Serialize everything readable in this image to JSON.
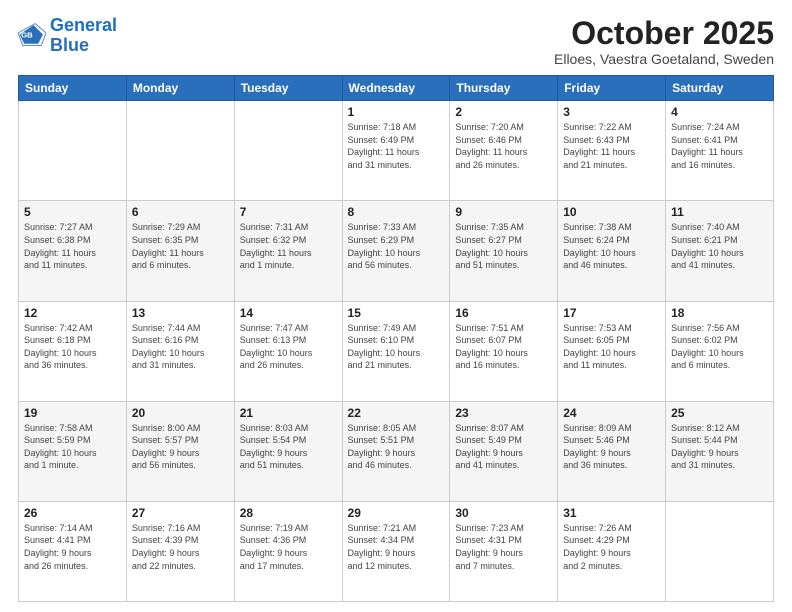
{
  "logo": {
    "line1": "General",
    "line2": "Blue"
  },
  "title": "October 2025",
  "subtitle": "Elloes, Vaestra Goetaland, Sweden",
  "weekdays": [
    "Sunday",
    "Monday",
    "Tuesday",
    "Wednesday",
    "Thursday",
    "Friday",
    "Saturday"
  ],
  "weeks": [
    [
      {
        "day": "",
        "info": ""
      },
      {
        "day": "",
        "info": ""
      },
      {
        "day": "",
        "info": ""
      },
      {
        "day": "1",
        "info": "Sunrise: 7:18 AM\nSunset: 6:49 PM\nDaylight: 11 hours\nand 31 minutes."
      },
      {
        "day": "2",
        "info": "Sunrise: 7:20 AM\nSunset: 6:46 PM\nDaylight: 11 hours\nand 26 minutes."
      },
      {
        "day": "3",
        "info": "Sunrise: 7:22 AM\nSunset: 6:43 PM\nDaylight: 11 hours\nand 21 minutes."
      },
      {
        "day": "4",
        "info": "Sunrise: 7:24 AM\nSunset: 6:41 PM\nDaylight: 11 hours\nand 16 minutes."
      }
    ],
    [
      {
        "day": "5",
        "info": "Sunrise: 7:27 AM\nSunset: 6:38 PM\nDaylight: 11 hours\nand 11 minutes."
      },
      {
        "day": "6",
        "info": "Sunrise: 7:29 AM\nSunset: 6:35 PM\nDaylight: 11 hours\nand 6 minutes."
      },
      {
        "day": "7",
        "info": "Sunrise: 7:31 AM\nSunset: 6:32 PM\nDaylight: 11 hours\nand 1 minute."
      },
      {
        "day": "8",
        "info": "Sunrise: 7:33 AM\nSunset: 6:29 PM\nDaylight: 10 hours\nand 56 minutes."
      },
      {
        "day": "9",
        "info": "Sunrise: 7:35 AM\nSunset: 6:27 PM\nDaylight: 10 hours\nand 51 minutes."
      },
      {
        "day": "10",
        "info": "Sunrise: 7:38 AM\nSunset: 6:24 PM\nDaylight: 10 hours\nand 46 minutes."
      },
      {
        "day": "11",
        "info": "Sunrise: 7:40 AM\nSunset: 6:21 PM\nDaylight: 10 hours\nand 41 minutes."
      }
    ],
    [
      {
        "day": "12",
        "info": "Sunrise: 7:42 AM\nSunset: 6:18 PM\nDaylight: 10 hours\nand 36 minutes."
      },
      {
        "day": "13",
        "info": "Sunrise: 7:44 AM\nSunset: 6:16 PM\nDaylight: 10 hours\nand 31 minutes."
      },
      {
        "day": "14",
        "info": "Sunrise: 7:47 AM\nSunset: 6:13 PM\nDaylight: 10 hours\nand 26 minutes."
      },
      {
        "day": "15",
        "info": "Sunrise: 7:49 AM\nSunset: 6:10 PM\nDaylight: 10 hours\nand 21 minutes."
      },
      {
        "day": "16",
        "info": "Sunrise: 7:51 AM\nSunset: 6:07 PM\nDaylight: 10 hours\nand 16 minutes."
      },
      {
        "day": "17",
        "info": "Sunrise: 7:53 AM\nSunset: 6:05 PM\nDaylight: 10 hours\nand 11 minutes."
      },
      {
        "day": "18",
        "info": "Sunrise: 7:56 AM\nSunset: 6:02 PM\nDaylight: 10 hours\nand 6 minutes."
      }
    ],
    [
      {
        "day": "19",
        "info": "Sunrise: 7:58 AM\nSunset: 5:59 PM\nDaylight: 10 hours\nand 1 minute."
      },
      {
        "day": "20",
        "info": "Sunrise: 8:00 AM\nSunset: 5:57 PM\nDaylight: 9 hours\nand 56 minutes."
      },
      {
        "day": "21",
        "info": "Sunrise: 8:03 AM\nSunset: 5:54 PM\nDaylight: 9 hours\nand 51 minutes."
      },
      {
        "day": "22",
        "info": "Sunrise: 8:05 AM\nSunset: 5:51 PM\nDaylight: 9 hours\nand 46 minutes."
      },
      {
        "day": "23",
        "info": "Sunrise: 8:07 AM\nSunset: 5:49 PM\nDaylight: 9 hours\nand 41 minutes."
      },
      {
        "day": "24",
        "info": "Sunrise: 8:09 AM\nSunset: 5:46 PM\nDaylight: 9 hours\nand 36 minutes."
      },
      {
        "day": "25",
        "info": "Sunrise: 8:12 AM\nSunset: 5:44 PM\nDaylight: 9 hours\nand 31 minutes."
      }
    ],
    [
      {
        "day": "26",
        "info": "Sunrise: 7:14 AM\nSunset: 4:41 PM\nDaylight: 9 hours\nand 26 minutes."
      },
      {
        "day": "27",
        "info": "Sunrise: 7:16 AM\nSunset: 4:39 PM\nDaylight: 9 hours\nand 22 minutes."
      },
      {
        "day": "28",
        "info": "Sunrise: 7:19 AM\nSunset: 4:36 PM\nDaylight: 9 hours\nand 17 minutes."
      },
      {
        "day": "29",
        "info": "Sunrise: 7:21 AM\nSunset: 4:34 PM\nDaylight: 9 hours\nand 12 minutes."
      },
      {
        "day": "30",
        "info": "Sunrise: 7:23 AM\nSunset: 4:31 PM\nDaylight: 9 hours\nand 7 minutes."
      },
      {
        "day": "31",
        "info": "Sunrise: 7:26 AM\nSunset: 4:29 PM\nDaylight: 9 hours\nand 2 minutes."
      },
      {
        "day": "",
        "info": ""
      }
    ]
  ]
}
